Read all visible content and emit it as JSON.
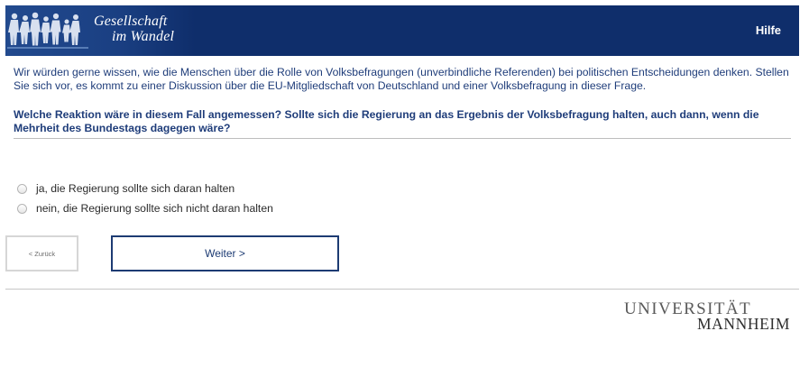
{
  "header": {
    "logo_line1": "Gesellschaft",
    "logo_line2": "im Wandel",
    "help_label": "Hilfe",
    "bg_color": "#0f2e6b"
  },
  "intro_text": "Wir würden gerne wissen, wie die Menschen über die Rolle von Volksbefragungen (unverbindliche Referenden) bei politischen Entscheidungen denken. Stellen Sie sich vor, es kommt zu einer Diskussion über die EU-Mitgliedschaft von Deutschland und einer Volksbefragung in dieser Frage.",
  "question_text": "Welche Reaktion wäre in diesem Fall angemessen? Sollte sich die Regierung an das Ergebnis der Volksbefragung halten, auch dann, wenn die Mehrheit des Bundestags dagegen wäre?",
  "options": [
    {
      "label": "ja, die Regierung sollte sich daran halten",
      "selected": false
    },
    {
      "label": "nein, die Regierung sollte sich nicht daran halten",
      "selected": false
    }
  ],
  "nav": {
    "back_label": "< Zurück",
    "next_label": "Weiter >"
  },
  "footer": {
    "uni_line1": "UNIVERSITÄT",
    "uni_line2": "MANNHEIM"
  }
}
